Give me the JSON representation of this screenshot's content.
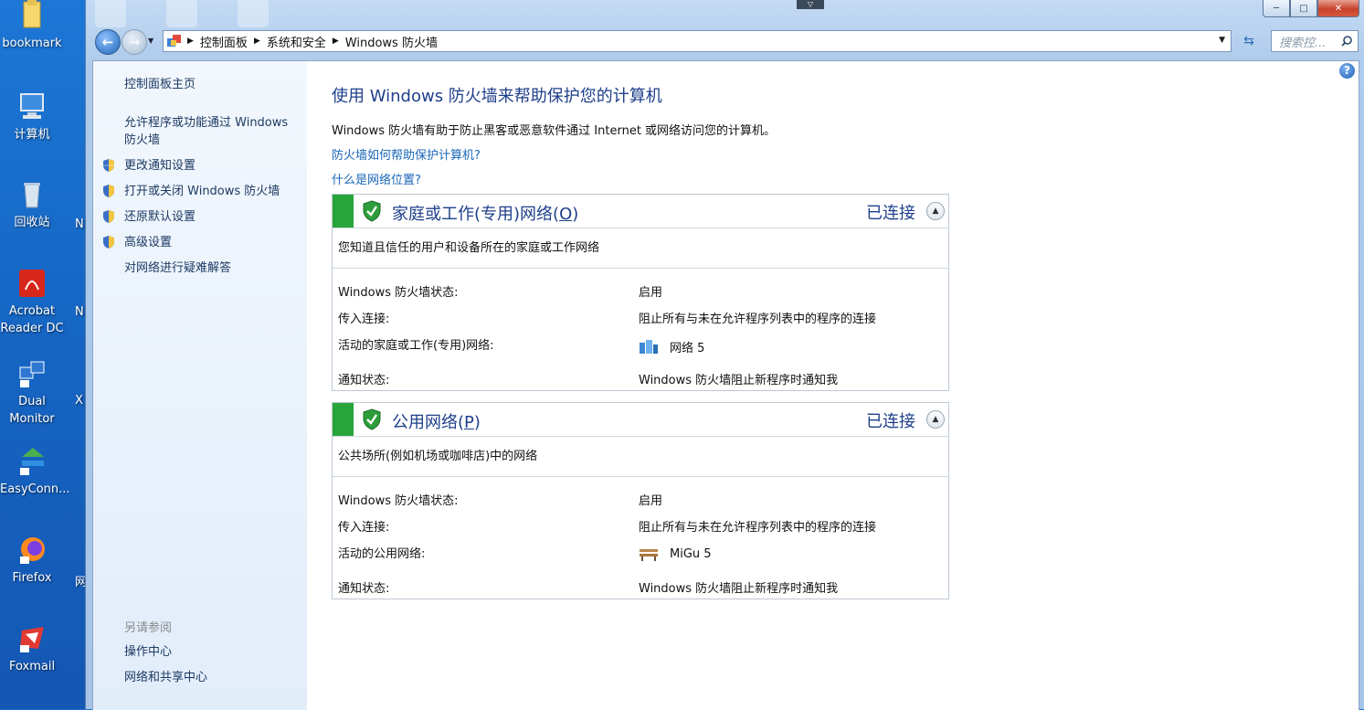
{
  "desktop": {
    "icons": [
      {
        "label": "bookmark"
      },
      {
        "label": "计算机"
      },
      {
        "label": "回收站"
      },
      {
        "label": "Acrobat Reader DC"
      },
      {
        "label": "Dual Monitor"
      },
      {
        "label": "EasyConn..."
      },
      {
        "label": "Firefox"
      },
      {
        "label": "Foxmail"
      }
    ],
    "edge_letters": [
      "N",
      "N",
      "X",
      "网"
    ]
  },
  "window": {
    "caption": {
      "minimize": "─",
      "maximize": "□",
      "close": "✕"
    }
  },
  "address_bar": {
    "crumbs": [
      "控制面板",
      "系统和安全",
      "Windows 防火墙"
    ],
    "search_placeholder": "搜索控..."
  },
  "left_pane": {
    "home": "控制面板主页",
    "allow_programs": "允许程序或功能通过 Windows 防火墙",
    "change_notify": "更改通知设置",
    "toggle_firewall": "打开或关闭 Windows 防火墙",
    "restore_defaults": "还原默认设置",
    "advanced": "高级设置",
    "troubleshoot": "对网络进行疑难解答",
    "see_also": "另请参阅",
    "action_center": "操作中心",
    "network_sharing": "网络和共享中心"
  },
  "main": {
    "title": "使用 Windows 防火墙来帮助保护您的计算机",
    "description": "Windows 防火墙有助于防止黑客或恶意软件通过 Internet 或网络访问您的计算机。",
    "link_how": "防火墙如何帮助保护计算机?",
    "link_location": "什么是网络位置?"
  },
  "networks": [
    {
      "title": "家庭或工作(专用)网络(",
      "hotkey": "O",
      "title_end": ")",
      "status": "已连接",
      "description": "您知道且信任的用户和设备所在的家庭或工作网络",
      "state_label": "Windows 防火墙状态:",
      "state_value": "启用",
      "incoming_label": "传入连接:",
      "incoming_value": "阻止所有与未在允许程序列表中的程序的连接",
      "active_label": "活动的家庭或工作(专用)网络:",
      "active_value": "网络  5",
      "notify_label": "通知状态:",
      "notify_value": "Windows 防火墙阻止新程序时通知我"
    },
    {
      "title": "公用网络(",
      "hotkey": "P",
      "title_end": ")",
      "status": "已连接",
      "description": "公共场所(例如机场或咖啡店)中的网络",
      "state_label": "Windows 防火墙状态:",
      "state_value": "启用",
      "incoming_label": "传入连接:",
      "incoming_value": "阻止所有与未在允许程序列表中的程序的连接",
      "active_label": "活动的公用网络:",
      "active_value": "MiGu  5",
      "notify_label": "通知状态:",
      "notify_value": "Windows 防火墙阻止新程序时通知我"
    }
  ],
  "colors": {
    "accent_green": "#27a53a",
    "heading_blue": "#1e3f8a",
    "link_blue": "#1a66b8"
  }
}
